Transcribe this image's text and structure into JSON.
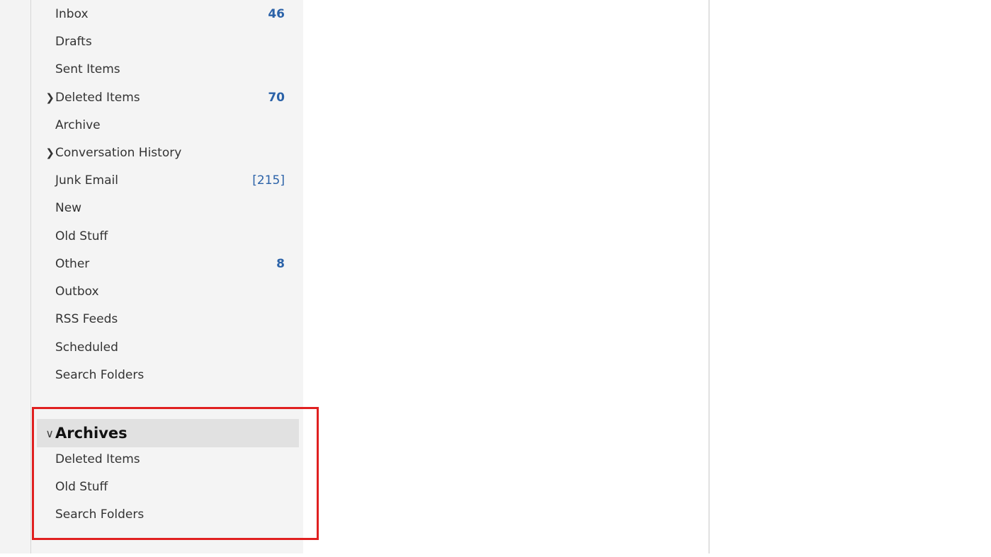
{
  "folders": [
    {
      "label": "Inbox",
      "count": "46",
      "expandable": false
    },
    {
      "label": "Drafts",
      "count": "",
      "expandable": false
    },
    {
      "label": "Sent Items",
      "count": "",
      "expandable": false
    },
    {
      "label": "Deleted Items",
      "count": "70",
      "expandable": true
    },
    {
      "label": "Archive",
      "count": "",
      "expandable": false
    },
    {
      "label": "Conversation History",
      "count": "",
      "expandable": true
    },
    {
      "label": "Junk Email",
      "count": "[215]",
      "expandable": false
    },
    {
      "label": "New",
      "count": "",
      "expandable": false
    },
    {
      "label": "Old Stuff",
      "count": "",
      "expandable": false
    },
    {
      "label": "Other",
      "count": "8",
      "expandable": false
    },
    {
      "label": "Outbox",
      "count": "",
      "expandable": false
    },
    {
      "label": "RSS Feeds",
      "count": "",
      "expandable": false
    },
    {
      "label": "Scheduled",
      "count": "",
      "expandable": false
    },
    {
      "label": "Search Folders",
      "count": "",
      "expandable": false
    }
  ],
  "archives": {
    "title": "Archives",
    "expanded_icon": "chevron-down-icon",
    "items": [
      {
        "label": "Deleted Items"
      },
      {
        "label": "Old Stuff"
      },
      {
        "label": "Search Folders"
      }
    ]
  },
  "icons": {
    "expand": "›",
    "collapse": "∨"
  },
  "colors": {
    "count": "#2b62a8",
    "highlight_border": "#e02020"
  }
}
